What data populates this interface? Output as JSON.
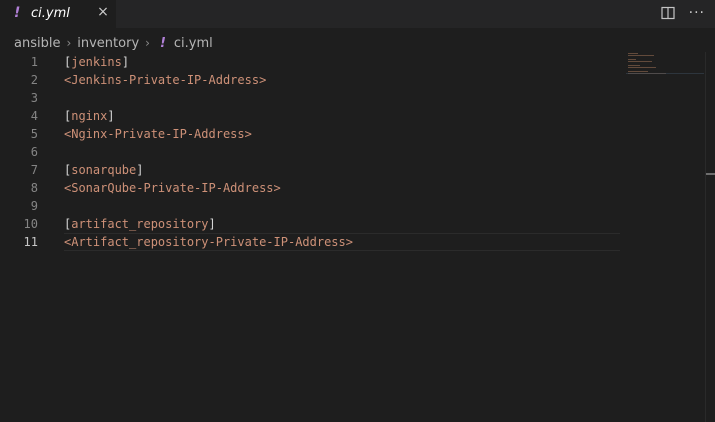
{
  "tab": {
    "icon": "!",
    "label": "ci.yml",
    "close": "×"
  },
  "actions": {
    "split_icon": "split-editor-icon",
    "more": "···"
  },
  "breadcrumb": {
    "items": [
      "ansible",
      "inventory"
    ],
    "file_icon": "!",
    "file": "ci.yml"
  },
  "editor": {
    "line_numbers": [
      "1",
      "2",
      "3",
      "4",
      "5",
      "6",
      "7",
      "8",
      "9",
      "10",
      "11"
    ],
    "active_line": 11,
    "lines": [
      {
        "type": "section",
        "name": "jenkins"
      },
      {
        "type": "value",
        "text": "<Jenkins-Private-IP-Address>"
      },
      {
        "type": "blank"
      },
      {
        "type": "section",
        "name": "nginx"
      },
      {
        "type": "value",
        "text": "<Nginx-Private-IP-Address>"
      },
      {
        "type": "blank"
      },
      {
        "type": "section",
        "name": "sonarqube"
      },
      {
        "type": "value",
        "text": "<SonarQube-Private-IP-Address>"
      },
      {
        "type": "blank"
      },
      {
        "type": "section",
        "name": "artifact_repository"
      },
      {
        "type": "value",
        "text": "<Artifact_repository-Private-IP-Address>"
      }
    ]
  },
  "colors": {
    "background": "#1e1e1e",
    "string": "#ce9178",
    "yaml_icon": "#b180d7"
  }
}
